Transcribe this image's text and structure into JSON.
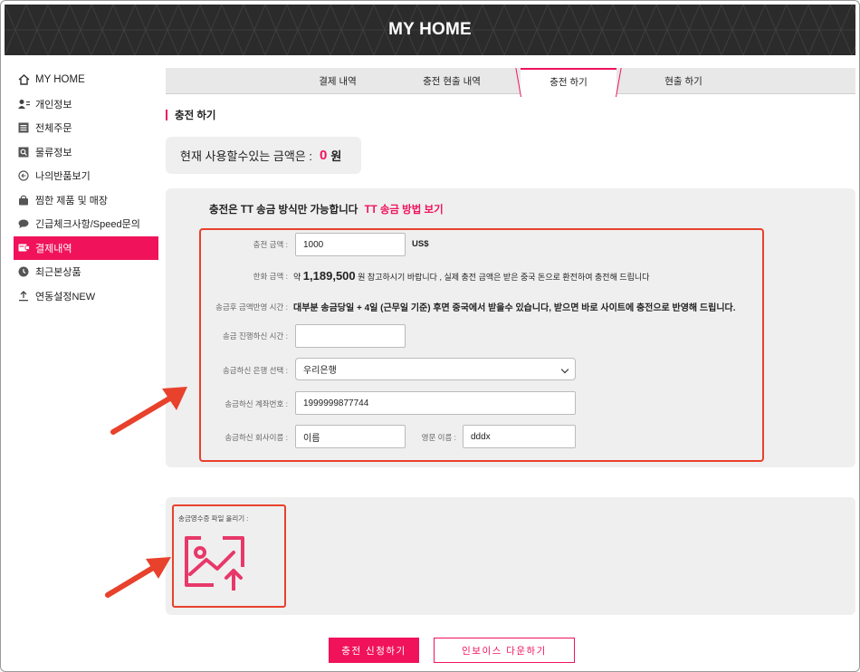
{
  "header": {
    "title": "MY HOME"
  },
  "sidebar": {
    "items": [
      {
        "label": "MY HOME",
        "icon": "home-icon"
      },
      {
        "label": "개인정보",
        "icon": "user-icon"
      },
      {
        "label": "전체주문",
        "icon": "list-icon"
      },
      {
        "label": "물류정보",
        "icon": "search-icon"
      },
      {
        "label": "나의반품보기",
        "icon": "return-icon"
      },
      {
        "label": "찜한 제품 및 매장",
        "icon": "bag-icon"
      },
      {
        "label": "긴급체크사항/Speed문의",
        "icon": "chat-icon"
      },
      {
        "label": "결제내역",
        "icon": "payment-icon",
        "active": true
      },
      {
        "label": "최근본상품",
        "icon": "clock-icon"
      },
      {
        "label": "연동설정NEW",
        "icon": "upload-icon"
      }
    ]
  },
  "tabs": [
    {
      "label": "결제 내역"
    },
    {
      "label": "충전 현출 내역"
    },
    {
      "label": "충전 하기",
      "active": true
    },
    {
      "label": "현출 하기"
    }
  ],
  "section": {
    "title": "충전 하기"
  },
  "balance": {
    "label": "현재 사용할수있는 금액은 :",
    "amount": "0",
    "unit": "원"
  },
  "notice": {
    "text": "충전은 TT 송금 방식만 가능합니다",
    "link": "TT 송금 방법 보기"
  },
  "form": {
    "charge_amount_label": "충전 금액 :",
    "charge_amount_value": "1000",
    "charge_amount_unit": "US$",
    "krw_label": "한화 금액 :",
    "krw_prefix": "약",
    "krw_value": "1,189,500",
    "krw_suffix": "원 참고하시기 바랍니다 , 실제 충전 금액은 받은 중국 돈으로 환전하여 충전해 드립니다",
    "deposit_time_label": "송금후 금액반영 시간 :",
    "deposit_time_text": "대부분 송금당일 + 4일 (근무일 기준) 후면 중국에서 받을수 있습니다, 받으면 바로 사이트에 충전으로 반영해 드립니다.",
    "transfer_time_label": "송금 진행하신 시간 :",
    "transfer_time_value": "",
    "bank_label": "송금하신 은행 선택 :",
    "bank_value": "우리은행",
    "account_label": "송금하신 계좌번호 :",
    "account_value": "1999999877744",
    "company_label": "송금하신 회사이름 :",
    "company_value": "이름",
    "english_name_label": "영문 이름 :",
    "english_name_value": "dddx"
  },
  "upload": {
    "label": "송금영수증 파일 올리기 :",
    "icon": "image-upload-icon"
  },
  "buttons": {
    "submit": "충전 신청하기",
    "invoice": "인보이스 다운하기"
  },
  "colors": {
    "accent": "#f0135c",
    "annotation": "#e8412c",
    "header_bg": "#2b2b2b",
    "panel_bg": "#efefef"
  }
}
